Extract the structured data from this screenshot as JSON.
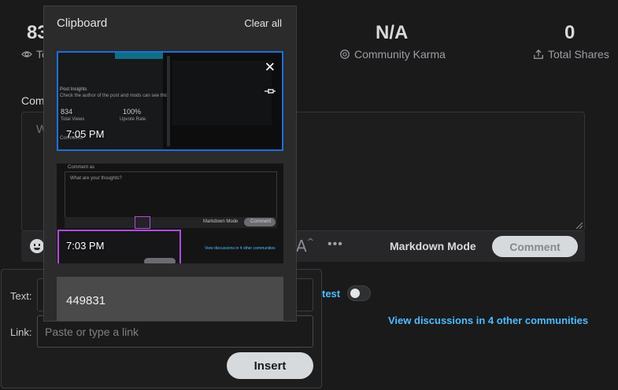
{
  "stats": [
    {
      "value": "83",
      "label": "To",
      "icon": "eye-icon"
    },
    {
      "value": "N/A",
      "label": "Community Karma",
      "icon": "karma-icon"
    },
    {
      "value": "0",
      "label": "Total Shares",
      "icon": "share-icon"
    }
  ],
  "comment": {
    "label": "Com",
    "placeholder": "W",
    "markdown_mode": "Markdown Mode",
    "submit": "Comment"
  },
  "contest": {
    "label": "test"
  },
  "discussions_link": "View discussions in 4 other communities",
  "link_popup": {
    "text_label": "Text:",
    "link_label": "Link:",
    "link_placeholder": "Paste or type a link",
    "insert": "Insert"
  },
  "clipboard": {
    "title": "Clipboard",
    "clear_all": "Clear all",
    "items": [
      {
        "type": "image",
        "time": "7:05 PM",
        "mini_text": [
          "Post Insights",
          "Check the author of the post and mods can see this",
          "834",
          "100%",
          "Total Views",
          "Upvote Rate",
          "Comments"
        ]
      },
      {
        "type": "image",
        "time": "7:03 PM",
        "mini_text": [
          "What are your thoughts?",
          "Markdown Mode",
          "Comment",
          "View discussions in 4 other communities"
        ]
      },
      {
        "type": "text",
        "text": "449831"
      }
    ]
  },
  "colors": {
    "accent_blue": "#4fbcff",
    "selected_border": "#1e6fd9",
    "highlight_purple": "#b04be0"
  }
}
